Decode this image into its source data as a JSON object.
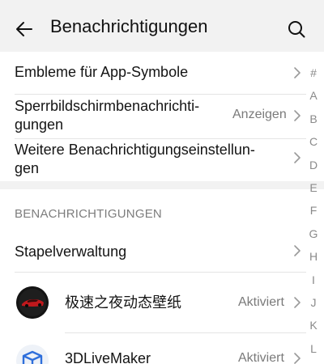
{
  "header": {
    "title": "Benachrichtigungen",
    "back_icon": "arrow-left-icon",
    "search_icon": "search-icon"
  },
  "settings": {
    "badges_label": "Embleme für App-Symbole",
    "lockscreen_label_line1": "Sperrbildschirmbenachrichti-",
    "lockscreen_label_line2": "gungen",
    "lockscreen_value": "Anzeigen",
    "more_label_line1": "Weitere Benachrichtigungseinstellun-",
    "more_label_line2": "gen"
  },
  "notifications": {
    "section_title": "BENACHRICHTIGUNGEN",
    "batch_label": "Stapelverwaltung",
    "apps": [
      {
        "name": "极速之夜动态壁纸",
        "status": "Aktiviert",
        "icon": "car-wallpaper-icon"
      },
      {
        "name": "3DLiveMaker",
        "status": "Aktiviert",
        "icon": "cube-icon"
      }
    ]
  },
  "alphabet_index": [
    "#",
    "A",
    "B",
    "C",
    "D",
    "E",
    "F",
    "G",
    "H",
    "I",
    "J",
    "K",
    "L"
  ],
  "colors": {
    "background": "#f2f2f2",
    "card": "#ffffff",
    "secondary_text": "#7a7a7a",
    "accent_blue": "#2f6fdb"
  }
}
